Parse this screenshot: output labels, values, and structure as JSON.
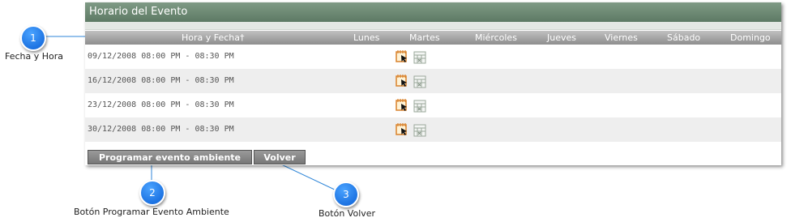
{
  "panel": {
    "title": "Horario del Evento",
    "columns": {
      "date": "Hora y Fecha†",
      "mon": "Lunes",
      "tue": "Martes",
      "wed": "Miércoles",
      "thu": "Jueves",
      "fri": "Viernes",
      "sat": "Sábado",
      "sun": "Domingo"
    },
    "rows": [
      {
        "datetime": "09/12/2008 08:00 PM - 08:30 PM"
      },
      {
        "datetime": "16/12/2008 08:00 PM - 08:30 PM"
      },
      {
        "datetime": "23/12/2008 08:00 PM - 08:30 PM"
      },
      {
        "datetime": "30/12/2008 08:00 PM - 08:30 PM"
      }
    ],
    "row_icons": [
      "calendar-edit-icon",
      "schedule-grid-icon"
    ]
  },
  "buttons": {
    "program": "Programar evento ambiente",
    "back": "Volver"
  },
  "callouts": [
    {
      "number": "1",
      "label": "Fecha y Hora"
    },
    {
      "number": "2",
      "label": "Botón Programar Evento Ambiente"
    },
    {
      "number": "3",
      "label": "Botón Volver"
    }
  ],
  "colors": {
    "header": "#6b8772",
    "callout": "#0a5fd6",
    "button": "#888888"
  }
}
